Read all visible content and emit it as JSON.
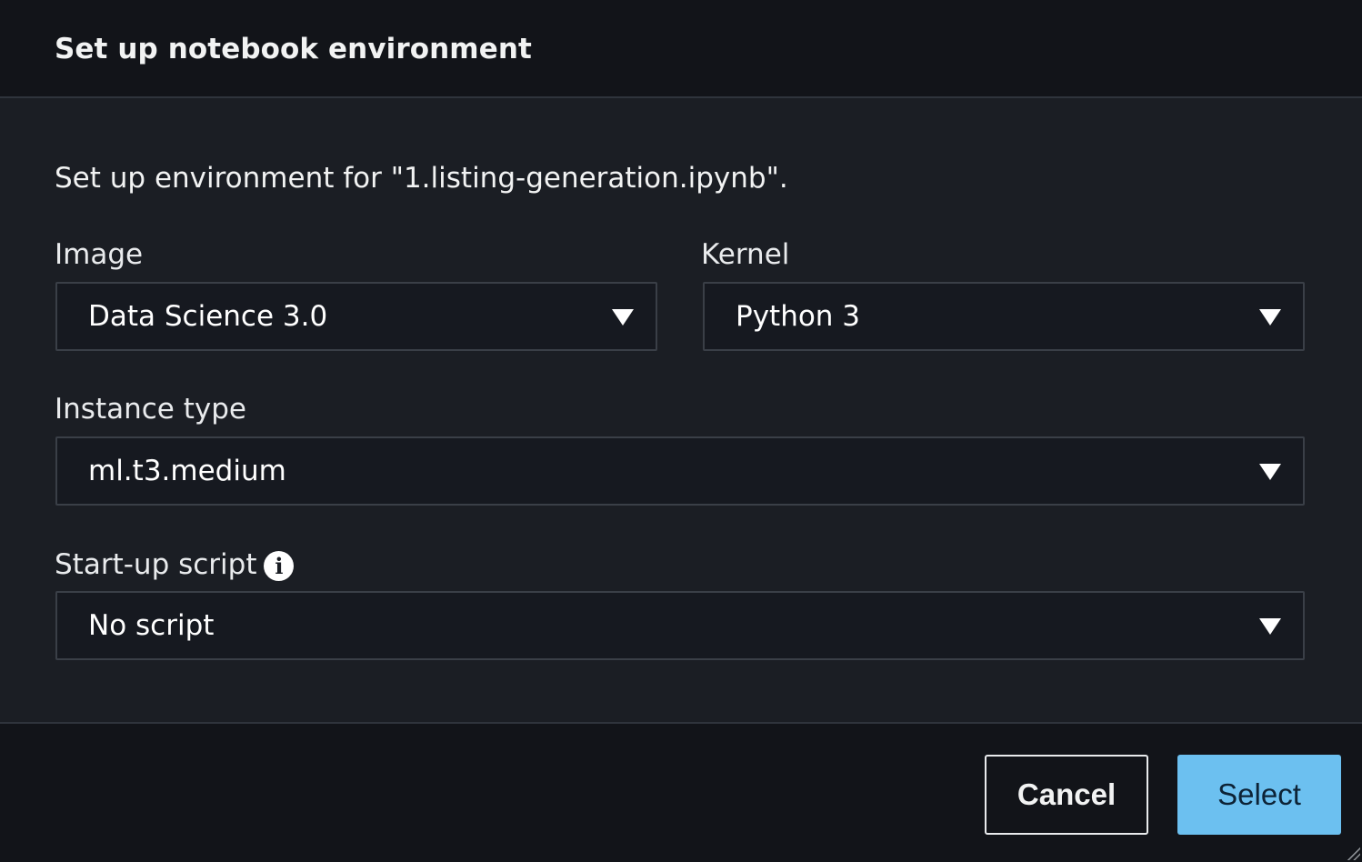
{
  "dialog": {
    "title": "Set up notebook environment",
    "description": "Set up environment for \"1.listing-generation.ipynb\"."
  },
  "fields": {
    "image": {
      "label": "Image",
      "value": "Data Science 3.0"
    },
    "kernel": {
      "label": "Kernel",
      "value": "Python 3"
    },
    "instance_type": {
      "label": "Instance type",
      "value": "ml.t3.medium"
    },
    "startup_script": {
      "label": "Start-up script",
      "value": "No script",
      "info_icon": "info-icon"
    }
  },
  "footer": {
    "cancel_label": "Cancel",
    "select_label": "Select"
  },
  "colors": {
    "background": "#1b1e24",
    "header_footer": "#121419",
    "primary_button": "#6cc0f0"
  }
}
